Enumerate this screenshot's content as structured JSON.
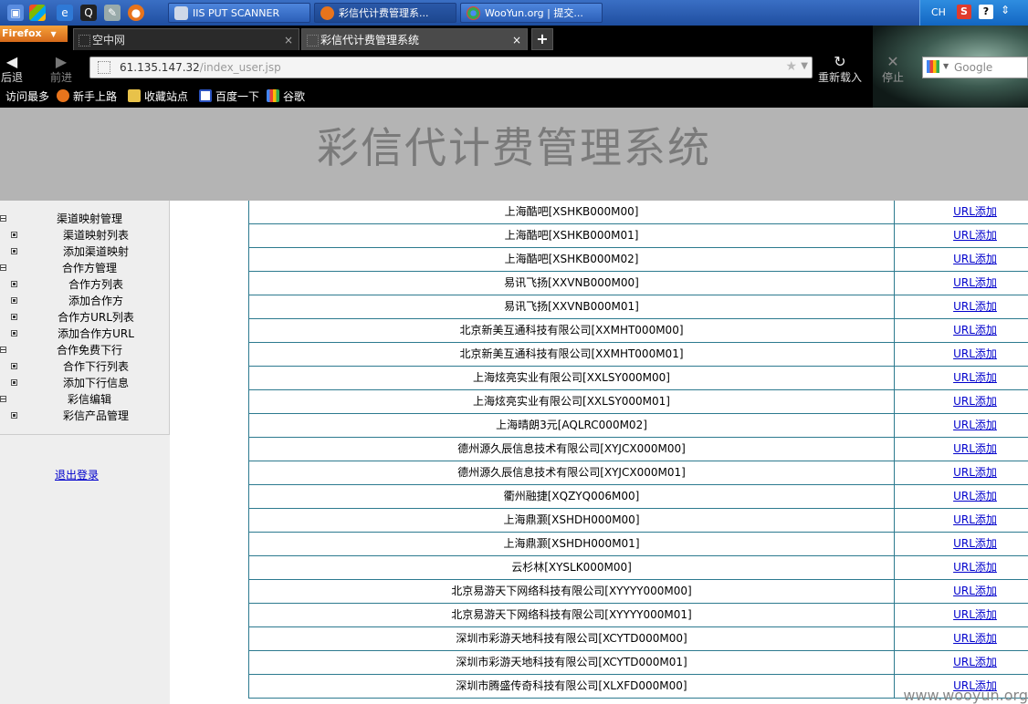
{
  "taskbar": {
    "windows": [
      "IIS PUT SCANNER",
      "彩信代计费管理系...",
      "WooYun.org | 提交..."
    ],
    "tray_lang": "CH"
  },
  "browser": {
    "menu_button": "Firefox",
    "tabs": [
      {
        "label": "空中网",
        "active": false
      },
      {
        "label": "彩信代计费管理系统",
        "active": true
      }
    ],
    "back_label": "后退",
    "forward_label": "前进",
    "reload_label": "重新载入",
    "stop_label": "停止",
    "url_host": "61.135.147.32",
    "url_path": "/index_user.jsp",
    "search_placeholder": "Google",
    "bookmarks": [
      "访问最多",
      "新手上路",
      "收藏站点",
      "百度一下",
      "谷歌"
    ]
  },
  "page": {
    "title": "彩信代计费管理系统",
    "sidebar": {
      "items": [
        {
          "label": "渠道映射管理",
          "type": "group"
        },
        {
          "label": "渠道映射列表",
          "type": "item"
        },
        {
          "label": "添加渠道映射",
          "type": "item"
        },
        {
          "label": "合作方管理",
          "type": "group"
        },
        {
          "label": "合作方列表",
          "type": "item"
        },
        {
          "label": "添加合作方",
          "type": "item"
        },
        {
          "label": "合作方URL列表",
          "type": "item"
        },
        {
          "label": "添加合作方URL",
          "type": "item"
        },
        {
          "label": "合作免费下行",
          "type": "group"
        },
        {
          "label": "合作下行列表",
          "type": "item"
        },
        {
          "label": "添加下行信息",
          "type": "item"
        },
        {
          "label": "彩信编辑",
          "type": "group"
        },
        {
          "label": "彩信产品管理",
          "type": "item"
        }
      ],
      "logout": "退出登录"
    },
    "action_label": "URL添加",
    "rows": [
      "上海酷吧[XSHKB000M00]",
      "上海酷吧[XSHKB000M01]",
      "上海酷吧[XSHKB000M02]",
      "易讯飞扬[XXVNB000M00]",
      "易讯飞扬[XXVNB000M01]",
      "北京新美互通科技有限公司[XXMHT000M00]",
      "北京新美互通科技有限公司[XXMHT000M01]",
      "上海炫亮实业有限公司[XXLSY000M00]",
      "上海炫亮实业有限公司[XXLSY000M01]",
      "上海晴朗3元[AQLRC000M02]",
      "德州源久辰信息技术有限公司[XYJCX000M00]",
      "德州源久辰信息技术有限公司[XYJCX000M01]",
      "衢州融捷[XQZYQ006M00]",
      "上海鼎灏[XSHDH000M00]",
      "上海鼎灏[XSHDH000M01]",
      "云杉林[XYSLK000M00]",
      "北京易游天下网络科技有限公司[XYYYY000M00]",
      "北京易游天下网络科技有限公司[XYYYY000M01]",
      "深圳市彩游天地科技有限公司[XCYTD000M00]",
      "深圳市彩游天地科技有限公司[XCYTD000M01]",
      "深圳市腾盛传奇科技有限公司[XLXFD000M00]"
    ]
  },
  "watermark": "www.wooyun.org"
}
